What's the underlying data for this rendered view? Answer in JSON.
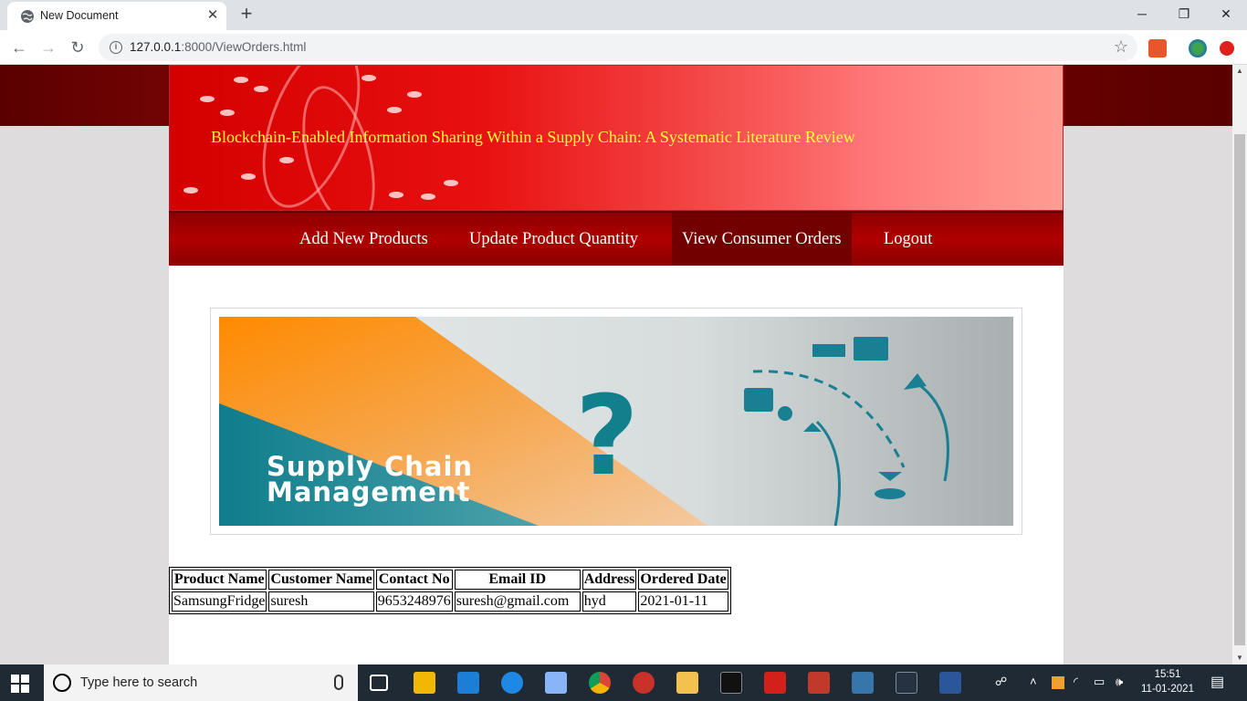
{
  "browser": {
    "tab_title": "New Document",
    "url_host": "127.0.0.1",
    "url_rest": ":8000/ViewOrders.html"
  },
  "site": {
    "title": "Blockchain-Enabled Information Sharing Within a Supply Chain: A Systematic Literature Review"
  },
  "menu": [
    {
      "label": "Add New Products"
    },
    {
      "label": "Update Product Quantity"
    },
    {
      "label": "View Consumer Orders",
      "active": true
    },
    {
      "label": "Logout"
    }
  ],
  "banner": {
    "line1": "Supply Chain",
    "line2": "Management",
    "question": "?"
  },
  "orders": {
    "headers": [
      "Product Name",
      "Customer Name",
      "Contact No",
      "Email ID",
      "Address",
      "Ordered Date"
    ],
    "rows": [
      [
        "SamsungFridge",
        "suresh",
        "9653248976",
        "suresh@gmail.com",
        "hyd",
        "2021-01-11"
      ]
    ]
  },
  "taskbar": {
    "search_placeholder": "Type here to search",
    "time": "15:51",
    "date": "11-01-2021"
  },
  "colors": {
    "title_yellow": "#ffff3c",
    "menu_red": "#a00000",
    "header_red": "#e81010"
  }
}
